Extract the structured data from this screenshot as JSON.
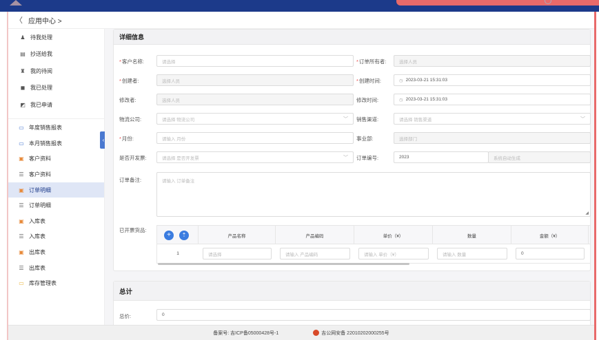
{
  "breadcrumb": {
    "back": "〈",
    "title": "应用中心 >"
  },
  "sidebar": {
    "top_items": [
      {
        "label": "待我处理",
        "icon": "person-todo-icon"
      },
      {
        "label": "抄送给我",
        "icon": "cc-doc-icon"
      },
      {
        "label": "我的待阅",
        "icon": "reader-icon"
      },
      {
        "label": "我已处理",
        "icon": "checked-icon"
      },
      {
        "label": "我已申请",
        "icon": "apply-icon"
      }
    ],
    "sub_items": [
      {
        "label": "年度销售报表",
        "icon": "report-icon",
        "active": false
      },
      {
        "label": "本月销售报表",
        "icon": "report-icon",
        "active": false
      },
      {
        "label": "客户资料",
        "icon": "doc-icon",
        "active": false
      },
      {
        "label": "客户资料",
        "icon": "list-icon",
        "active": false
      },
      {
        "label": "订单明细",
        "icon": "doc-icon",
        "active": true
      },
      {
        "label": "订单明细",
        "icon": "list-icon",
        "active": false
      },
      {
        "label": "入库表",
        "icon": "doc-icon",
        "active": false
      },
      {
        "label": "入库表",
        "icon": "list-icon",
        "active": false
      },
      {
        "label": "出库表",
        "icon": "doc-icon",
        "active": false
      },
      {
        "label": "出库表",
        "icon": "list-icon",
        "active": false
      },
      {
        "label": "库存管理表",
        "icon": "report-icon",
        "active": false
      }
    ]
  },
  "detail": {
    "title": "详细信息",
    "fields": {
      "customer_name": {
        "label": "客户名称:",
        "placeholder": "请选择"
      },
      "order_owner": {
        "label": "订单所有者:",
        "placeholder": "选择人员"
      },
      "creator": {
        "label": "创建者:",
        "placeholder": "选择人员"
      },
      "created_time": {
        "label": "创建时间:",
        "value": "2023-03-21 15:31:03"
      },
      "modifier": {
        "label": "修改者:",
        "placeholder": "选择人员"
      },
      "modified_time": {
        "label": "修改时间:",
        "value": "2023-03-21 15:31:03"
      },
      "logistics": {
        "label": "物流公司:",
        "placeholder": "请选择 物流公司"
      },
      "channel": {
        "label": "销售渠道:",
        "placeholder": "请选择 销售渠道"
      },
      "month": {
        "label": "月份:",
        "placeholder": "请输入 月份"
      },
      "department": {
        "label": "事业部:",
        "placeholder": "选择部门"
      },
      "invoice": {
        "label": "是否开发票:",
        "placeholder": "请选择 是否开发票"
      },
      "order_no": {
        "label": "订单编号:",
        "value": "2023",
        "auto": "系统自动生成"
      },
      "remark": {
        "label": "订单备注:",
        "placeholder": "请输入 订单备注"
      },
      "invoiced_goods": {
        "label": "已开票货品:"
      }
    },
    "table": {
      "headers": [
        "产品名称",
        "产品编码",
        "单价（¥）",
        "数量",
        "金额（¥）"
      ],
      "row_index": "1",
      "row": {
        "product": "请选择",
        "code": "请输入 产品编码",
        "price": "请输入 单价（¥）",
        "qty": "请输入 数量",
        "amount": "0"
      }
    }
  },
  "total": {
    "title": "总计",
    "label": "总价:",
    "value": "0"
  },
  "footer": {
    "icp": "备案号: 吉ICP备05000428号-1",
    "police": "吉公网安备 22010202000255号"
  }
}
